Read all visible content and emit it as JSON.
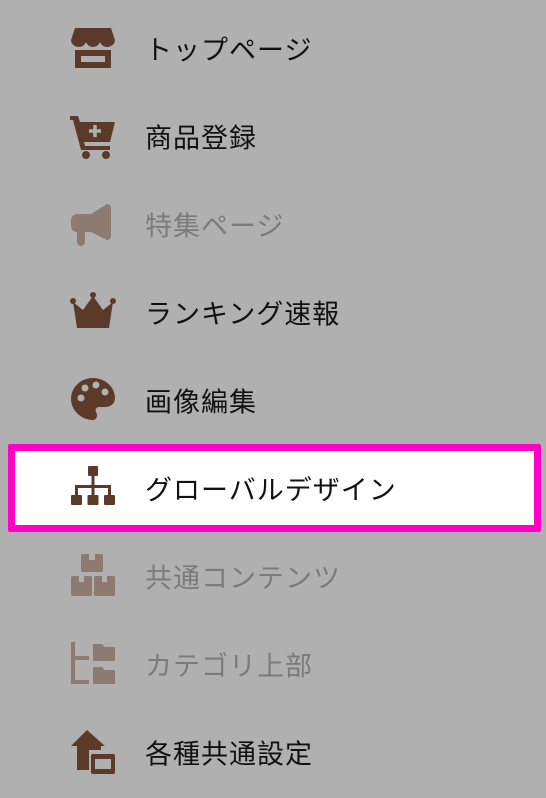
{
  "menu": {
    "items": [
      {
        "label": "トップページ",
        "icon": "store-icon",
        "state": "enabled"
      },
      {
        "label": "商品登録",
        "icon": "cart-plus-icon",
        "state": "enabled"
      },
      {
        "label": "特集ページ",
        "icon": "megaphone-icon",
        "state": "disabled"
      },
      {
        "label": "ランキング速報",
        "icon": "crown-icon",
        "state": "enabled"
      },
      {
        "label": "画像編集",
        "icon": "palette-icon",
        "state": "enabled"
      },
      {
        "label": "グローバルデザイン",
        "icon": "sitemap-icon",
        "state": "selected"
      },
      {
        "label": "共通コンテンツ",
        "icon": "boxes-icon",
        "state": "disabled"
      },
      {
        "label": "カテゴリ上部",
        "icon": "folder-tree-icon",
        "state": "disabled"
      },
      {
        "label": "各種共通設定",
        "icon": "house-setting-icon",
        "state": "enabled"
      }
    ]
  },
  "colors": {
    "background": "#b0b0b0",
    "icon_active": "#5b3a29",
    "icon_disabled": "#8d7a70",
    "highlight_border": "#ff00c8",
    "text_disabled": "#7b7b7b"
  }
}
